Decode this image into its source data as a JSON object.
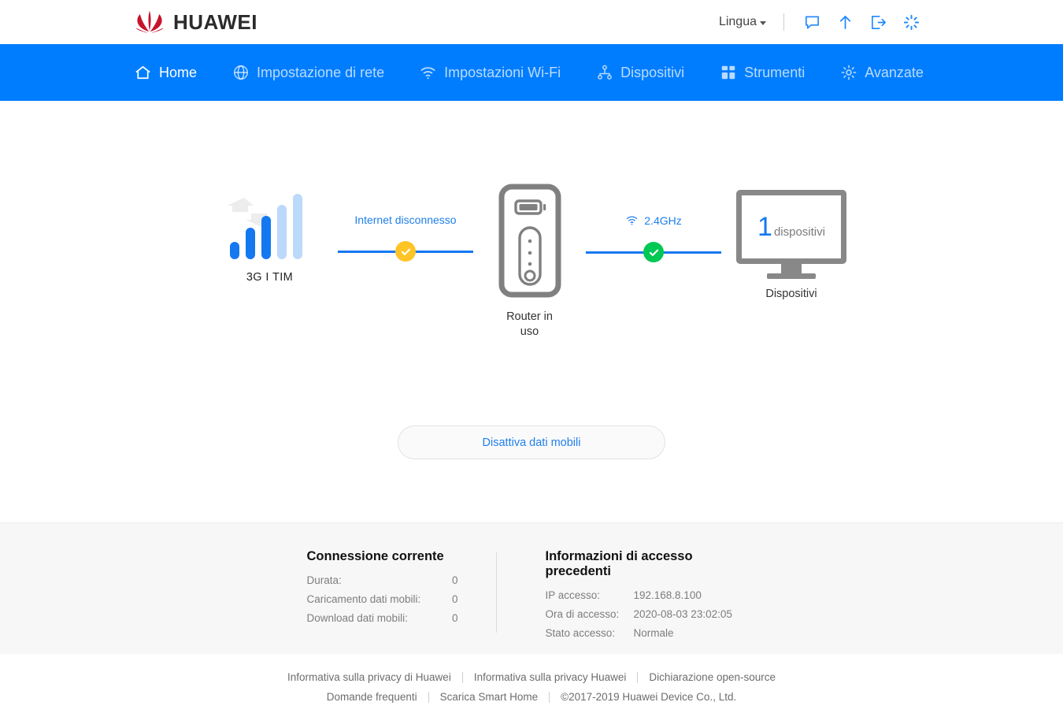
{
  "brand": {
    "name": "HUAWEI",
    "logo_color": "#C7132C"
  },
  "topbar": {
    "language_label": "Lingua",
    "icons": [
      {
        "name": "chat-icon",
        "glyph": "speech-bubble"
      },
      {
        "name": "upload-icon",
        "glyph": "arrow-up"
      },
      {
        "name": "logout-icon",
        "glyph": "exit"
      },
      {
        "name": "loading-icon",
        "glyph": "spinner"
      }
    ]
  },
  "nav": {
    "accent_color": "#007DFF",
    "items": [
      {
        "label": "Home",
        "icon": "home-icon",
        "active": true
      },
      {
        "label": "Impostazione di rete",
        "icon": "globe-icon",
        "active": false
      },
      {
        "label": "Impostazioni Wi-Fi",
        "icon": "wifi-icon",
        "active": false
      },
      {
        "label": "Dispositivi",
        "icon": "devices-tree-icon",
        "active": false
      },
      {
        "label": "Strumenti",
        "icon": "grid-icon",
        "active": false
      },
      {
        "label": "Avanzate",
        "icon": "gear-icon",
        "active": false
      }
    ]
  },
  "topology": {
    "signal": {
      "label": "3G I TIM",
      "bars_total": 5,
      "bars_active": 3,
      "active_color": "#1478F0",
      "inactive_color": "#BCD9FA",
      "arrows_color": "#EDEDED"
    },
    "wan_link": {
      "status_text": "Internet disconnesso",
      "badge_state": "warn",
      "badge_color": "#FFC425",
      "line_color": "#1478F0"
    },
    "router": {
      "label": "Router in uso",
      "outline_color": "#808080"
    },
    "lan_link": {
      "status_text": "2.4GHz",
      "icon": "wifi-icon",
      "badge_state": "ok",
      "badge_color": "#00C853",
      "line_color": "#1478F0"
    },
    "devices": {
      "count": "1",
      "count_unit": "dispositivi",
      "label": "Dispositivi",
      "count_color": "#1478F0"
    }
  },
  "actions": {
    "mobile_data_button": "Disattiva dati mobili"
  },
  "info": {
    "current_connection": {
      "title": "Connessione corrente",
      "rows": [
        {
          "key": "Durata:",
          "value": "0"
        },
        {
          "key": "Caricamento dati mobili:",
          "value": "0"
        },
        {
          "key": "Download dati mobili:",
          "value": "0"
        }
      ]
    },
    "previous_access": {
      "title": "Informazioni di accesso precedenti",
      "rows": [
        {
          "key": "IP accesso:",
          "value": "192.168.8.100"
        },
        {
          "key": "Ora di accesso:",
          "value": "2020-08-03 23:02:05"
        },
        {
          "key": "Stato accesso:",
          "value": "Normale"
        }
      ]
    }
  },
  "footer": {
    "row1": [
      "Informativa sulla privacy di Huawei",
      "Informativa sulla privacy Huawei",
      "Dichiarazione open-source"
    ],
    "row2_links": [
      "Domande frequenti",
      "Scarica Smart Home"
    ],
    "copyright": "©2017-2019 Huawei Device Co., Ltd."
  }
}
